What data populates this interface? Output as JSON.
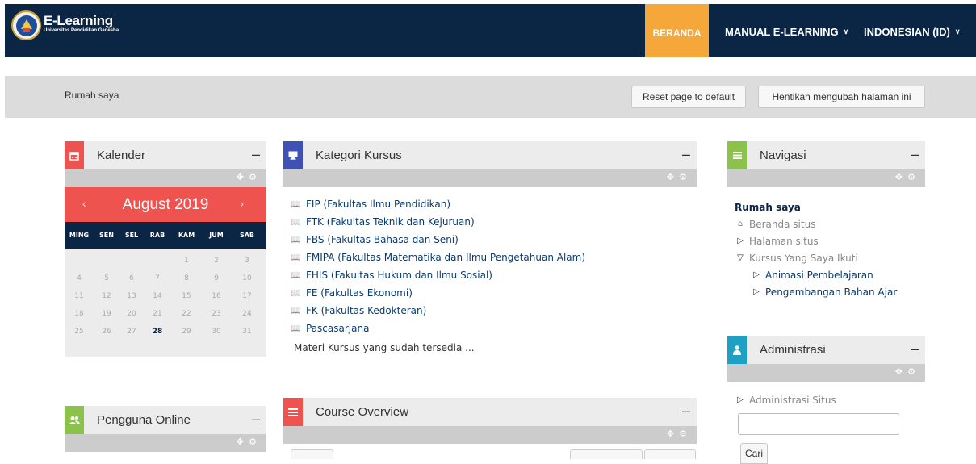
{
  "navbar": {
    "brand_title": "E-Learning",
    "brand_subtitle": "Universitas Pendidikan Ganesha",
    "home": "BERANDA",
    "manual": "MANUAL E-LEARNING",
    "language": "INDONESIAN (ID)",
    "bg_color": "#0b2545",
    "accent_color": "#f6a73a"
  },
  "header": {
    "breadcrumb": "Rumah saya",
    "reset_button": "Reset page to default",
    "stop_edit_button": "Hentikan mengubah halaman ini"
  },
  "calendar": {
    "title": "Kalender",
    "month": "August 2019",
    "prev": "‹",
    "next": "›",
    "days": [
      "MING",
      "SEN",
      "SEL",
      "RAB",
      "KAM",
      "JUM",
      "SAB"
    ],
    "weeks": [
      [
        "",
        "",
        "",
        "",
        "1",
        "2",
        "3"
      ],
      [
        "4",
        "5",
        "6",
        "7",
        "8",
        "9",
        "10"
      ],
      [
        "11",
        "12",
        "13",
        "14",
        "15",
        "16",
        "17"
      ],
      [
        "18",
        "19",
        "20",
        "21",
        "22",
        "23",
        "24"
      ],
      [
        "25",
        "26",
        "27",
        "28",
        "29",
        "30",
        "31"
      ]
    ],
    "today": "28",
    "icon_color": "#ef5350"
  },
  "online": {
    "title": "Pengguna Online",
    "icon_color": "#8bc34a"
  },
  "categories": {
    "title": "Kategori Kursus",
    "items": [
      "FIP (Fakultas Ilmu Pendidikan)",
      "FTK (Fakultas Teknik dan Kejuruan)",
      "FBS (Fakultas Bahasa dan Seni)",
      "FMIPA (Fakultas Matematika dan Ilmu Pengetahuan Alam)",
      "FHIS (Fakultas Hukum dan Ilmu Sosial)",
      "FE (Fakultas Ekonomi)",
      "FK (Fakultas Kedokteran)",
      "Pascasarjana"
    ],
    "more": "Materi Kursus yang sudah tersedia ...",
    "icon_color": "#3f51b5"
  },
  "overview": {
    "title": "Course Overview",
    "icon_color": "#ef5350"
  },
  "navigation": {
    "title": "Navigasi",
    "home": "Rumah saya",
    "site_home": "Beranda situs",
    "site_pages": "Halaman situs",
    "my_courses": "Kursus Yang Saya Ikuti",
    "course_1": "Animasi Pembelajaran",
    "course_2": "Pengembangan Bahan Ajar",
    "icon_color": "#8bc34a"
  },
  "administration": {
    "title": "Administrasi",
    "site_admin": "Administrasi Situs",
    "search_button": "Cari",
    "icon_color": "#1e9fc4"
  },
  "block_minimize": "–"
}
